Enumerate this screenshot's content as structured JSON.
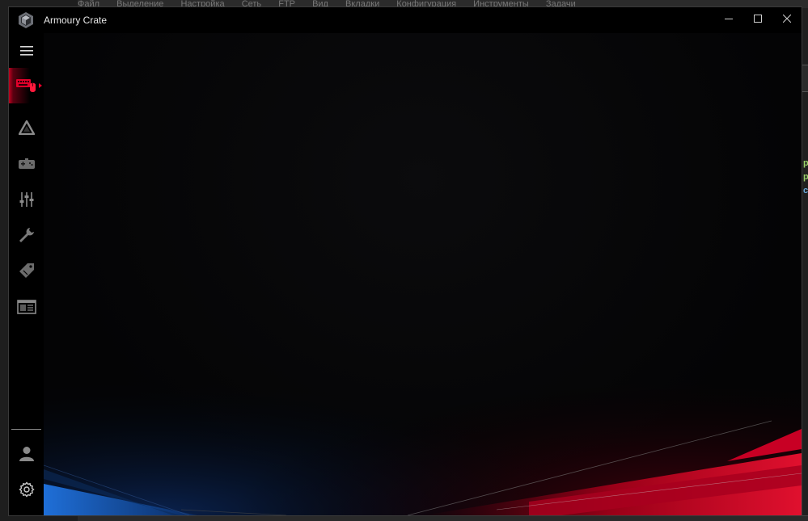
{
  "background_app": {
    "menu_items": [
      "Файл",
      "Выделение",
      "Настройка",
      "Сеть",
      "FTP",
      "Вид",
      "Вкладки",
      "Конфигурация",
      "Инструменты",
      "Задачи"
    ],
    "right_strip_letters": [
      {
        "text": "p",
        "color": "#9bd06a"
      },
      {
        "text": "p",
        "color": "#9bd06a"
      },
      {
        "text": "c",
        "color": "#6aa8d8"
      }
    ]
  },
  "window": {
    "title": "Armoury Crate",
    "controls": {
      "minimize": "minimize-icon",
      "maximize": "maximize-icon",
      "close": "close-icon"
    }
  },
  "sidebar": {
    "menu_icon": "hamburger-menu-icon",
    "items": [
      {
        "id": "devices",
        "icon": "keyboard-mouse-icon",
        "active": true
      },
      {
        "id": "aura",
        "icon": "aura-triangle-icon",
        "active": false
      },
      {
        "id": "game-library",
        "icon": "gamepad-icon",
        "active": false
      },
      {
        "id": "scenario-profiles",
        "icon": "sliders-icon",
        "active": false
      },
      {
        "id": "tools",
        "icon": "wrench-icon",
        "active": false
      },
      {
        "id": "deals",
        "icon": "tag-icon",
        "active": false
      },
      {
        "id": "news",
        "icon": "news-icon",
        "active": false
      }
    ],
    "bottom_items": [
      {
        "id": "user",
        "icon": "user-icon"
      },
      {
        "id": "settings",
        "icon": "gear-icon"
      }
    ]
  },
  "colors": {
    "accent_red": "#e8002a",
    "accent_blue": "#1f6fd8",
    "window_bg": "#050505"
  }
}
